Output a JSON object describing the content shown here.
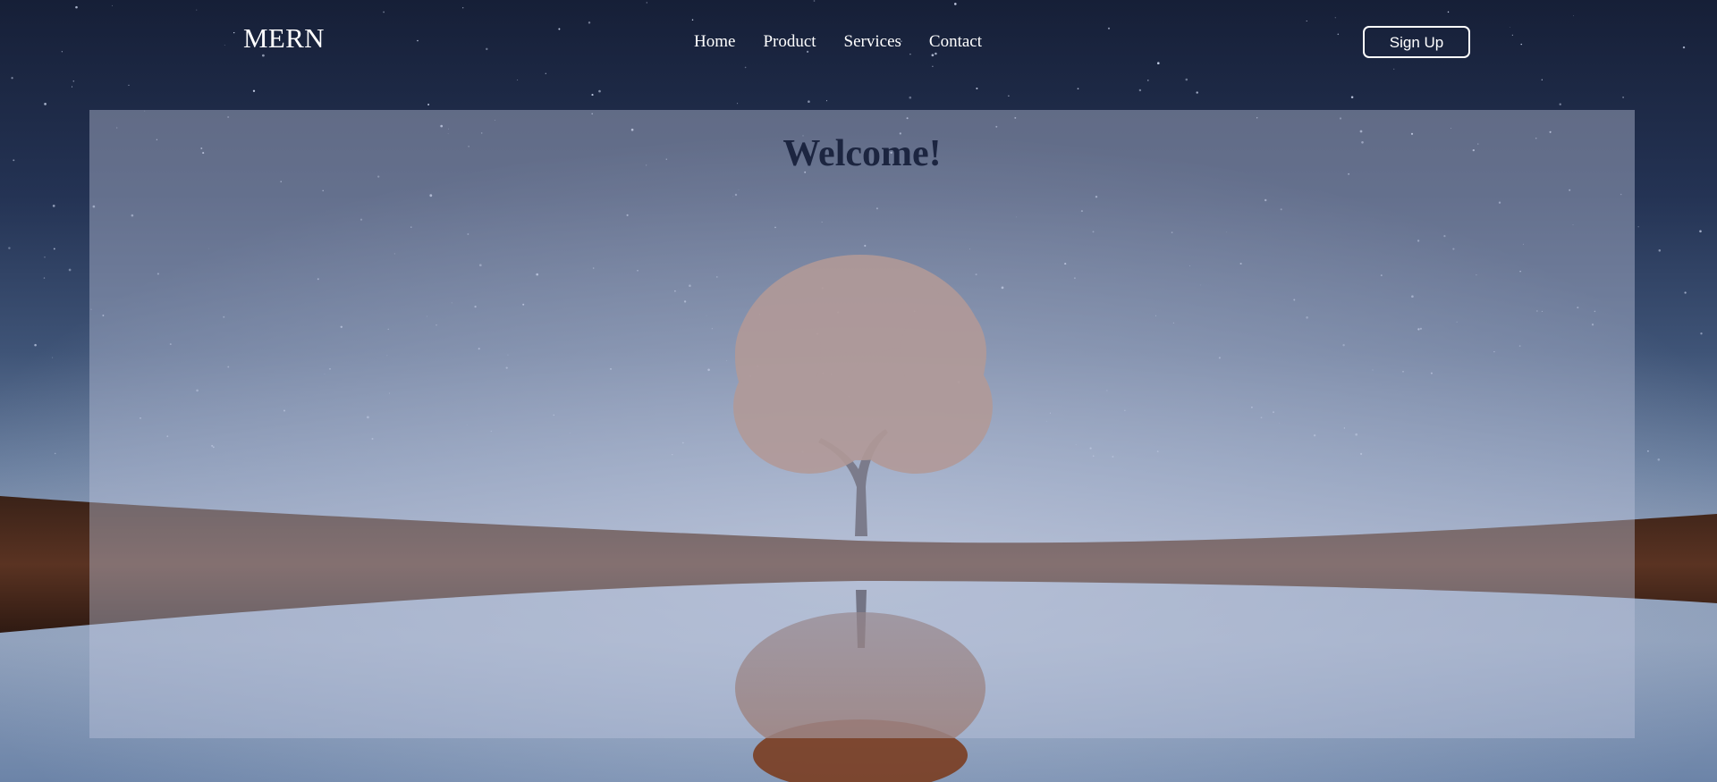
{
  "header": {
    "brand": "MERN",
    "nav": [
      {
        "label": "Home"
      },
      {
        "label": "Product"
      },
      {
        "label": "Services"
      },
      {
        "label": "Contact"
      }
    ],
    "signup_label": "Sign Up"
  },
  "main": {
    "heading": "Welcome!"
  },
  "colors": {
    "heading": "#1c2540",
    "nav_text": "#ffffff",
    "sky_top": "#18213a",
    "tree_foliage": "#a87a66"
  }
}
